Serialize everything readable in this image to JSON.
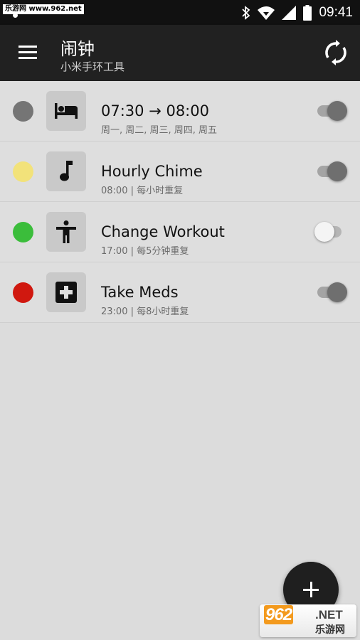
{
  "status_bar": {
    "watermark": "乐游网 www.962.net",
    "time": "09:41"
  },
  "app_bar": {
    "title": "闹钟",
    "subtitle": "小米手环工具",
    "menu_icon": "hamburger-menu-icon",
    "sync_icon": "sync-icon"
  },
  "alarms": [
    {
      "color": "#757575",
      "icon": "bed-icon",
      "title": "07:30 → 08:00",
      "subtitle": "周一, 周二, 周三, 周四, 周五",
      "enabled": true
    },
    {
      "color": "#f2e27a",
      "icon": "music-note-icon",
      "title": "Hourly Chime",
      "subtitle": "08:00 | 每小时重复",
      "enabled": true
    },
    {
      "color": "#3bbd3b",
      "icon": "person-workout-icon",
      "title": "Change Workout",
      "subtitle": "17:00 | 每5分钟重复",
      "enabled": false
    },
    {
      "color": "#d0180f",
      "icon": "medical-cross-icon",
      "title": "Take Meds",
      "subtitle": "23:00 | 每8小时重复",
      "enabled": true
    }
  ],
  "fab": {
    "icon": "plus-icon"
  },
  "watermark_bottom": {
    "big": "962",
    "net": ".NET",
    "cn": "乐游网"
  }
}
